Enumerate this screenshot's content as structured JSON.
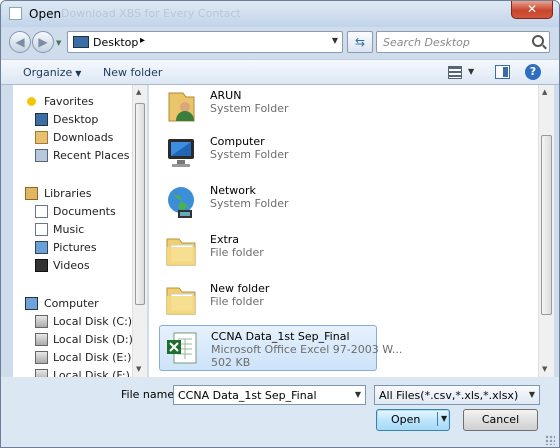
{
  "window": {
    "title": "Open",
    "ghost_title": "Download XBS for Every Contact",
    "close_glyph": "✕"
  },
  "nav": {
    "back_icon": "back-arrow-icon",
    "forward_icon": "forward-arrow-icon",
    "address_location": "Desktop",
    "address_chevron": "▸",
    "search_placeholder": "Search Desktop"
  },
  "toolbar": {
    "organize_label": "Organize",
    "new_folder_label": "New folder",
    "help_label": "?"
  },
  "sidebar": {
    "items": [
      {
        "label": "Favorites",
        "icon": "star-icon",
        "group": true
      },
      {
        "label": "Desktop",
        "icon": "desktop-icon",
        "group": false
      },
      {
        "label": "Downloads",
        "icon": "downloads-icon",
        "group": false
      },
      {
        "label": "Recent Places",
        "icon": "recent-places-icon",
        "group": false
      },
      {
        "label": "Libraries",
        "icon": "libraries-icon",
        "group": true
      },
      {
        "label": "Documents",
        "icon": "documents-icon",
        "group": false
      },
      {
        "label": "Music",
        "icon": "music-icon",
        "group": false
      },
      {
        "label": "Pictures",
        "icon": "pictures-icon",
        "group": false
      },
      {
        "label": "Videos",
        "icon": "videos-icon",
        "group": false
      },
      {
        "label": "Computer",
        "icon": "computer-icon",
        "group": true
      },
      {
        "label": "Local Disk (C:)",
        "icon": "disk-icon",
        "group": false
      },
      {
        "label": "Local Disk (D:)",
        "icon": "disk-icon",
        "group": false
      },
      {
        "label": "Local Disk (E:)",
        "icon": "disk-icon",
        "group": false
      },
      {
        "label": "Local Disk (F:)",
        "icon": "disk-icon",
        "group": false
      }
    ]
  },
  "files": [
    {
      "name": "ARUN",
      "type": "System Folder",
      "size": "",
      "icon": "user-folder-icon"
    },
    {
      "name": "Computer",
      "type": "System Folder",
      "size": "",
      "icon": "computer-icon"
    },
    {
      "name": "Network",
      "type": "System Folder",
      "size": "",
      "icon": "network-globe-icon"
    },
    {
      "name": "Extra",
      "type": "File folder",
      "size": "",
      "icon": "folder-icon"
    },
    {
      "name": "New folder",
      "type": "File folder",
      "size": "",
      "icon": "folder-icon"
    },
    {
      "name": "CCNA Data_1st Sep_Final",
      "type": "Microsoft Office Excel 97-2003 W...",
      "size": "502 KB",
      "icon": "excel-file-icon"
    }
  ],
  "footer": {
    "file_name_label": "File name:",
    "file_name_value": "CCNA Data_1st Sep_Final",
    "filter_value": "All Files(*.csv,*.xls,*.xlsx)",
    "open_label": "Open",
    "cancel_label": "Cancel"
  },
  "colors": {
    "selection": "#cde3fa",
    "chrome": "#dce7f4",
    "close": "#c7452b"
  }
}
